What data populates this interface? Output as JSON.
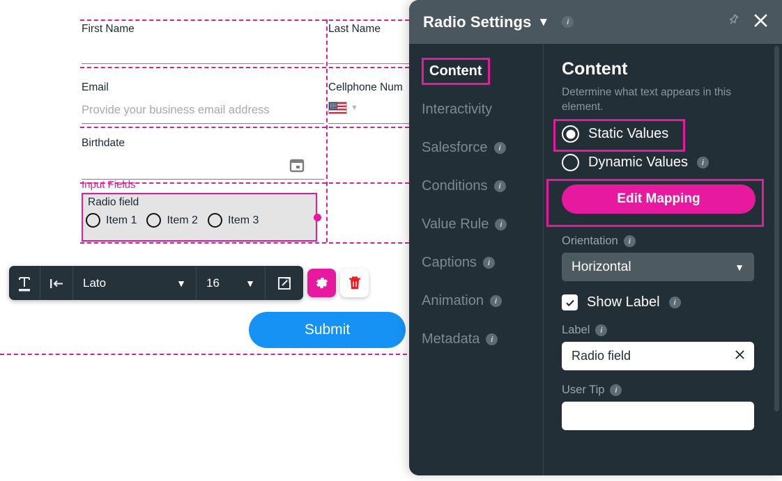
{
  "canvas": {
    "fields": [
      {
        "name": "first-name",
        "label": "First Name",
        "placeholder": "",
        "value": ""
      },
      {
        "name": "last-name",
        "label": "Last Name",
        "placeholder": "",
        "value": ""
      },
      {
        "name": "email",
        "label": "Email",
        "placeholder": "Provide your business email address",
        "value": ""
      },
      {
        "name": "cellphone",
        "label": "Cellphone Num",
        "placeholder": "",
        "value": ""
      },
      {
        "name": "birthdate",
        "label": "Birthdate",
        "placeholder": "",
        "value": ""
      }
    ],
    "selected_element": {
      "group_tag": "Input Fields",
      "label": "Radio field",
      "options": [
        "Item 1",
        "Item 2",
        "Item 3"
      ]
    },
    "submit_label": "Submit",
    "toolbar": {
      "text_icon": "text-format-icon",
      "align_icon": "align-left-icon",
      "font_family": "Lato",
      "font_size": "16",
      "link_icon": "external-link-icon",
      "gear_icon": "gear-icon",
      "trash_icon": "trash-icon"
    },
    "calendar_icon": "calendar-icon",
    "flag_icon": "us-flag-icon"
  },
  "panel": {
    "title": "Radio Settings",
    "title_chevron": "chevron-down-icon",
    "info_icon": "info-icon",
    "pin_icon": "pin-icon",
    "close_icon": "close-icon",
    "nav": [
      {
        "label": "Content",
        "info": false,
        "active": true
      },
      {
        "label": "Interactivity",
        "info": false,
        "active": false
      },
      {
        "label": "Salesforce",
        "info": true,
        "active": false
      },
      {
        "label": "Conditions",
        "info": true,
        "active": false
      },
      {
        "label": "Value Rule",
        "info": true,
        "active": false
      },
      {
        "label": "Captions",
        "info": true,
        "active": false
      },
      {
        "label": "Animation",
        "info": true,
        "active": false
      },
      {
        "label": "Metadata",
        "info": true,
        "active": false
      }
    ],
    "section": {
      "title": "Content",
      "description": "Determine what text appears in this element.",
      "static_values_label": "Static Values",
      "dynamic_values_label": "Dynamic Values",
      "edit_mapping_label": "Edit Mapping",
      "orientation_label": "Orientation",
      "orientation_value": "Horizontal",
      "orientation_chevron": "chevron-down-icon",
      "show_label_label": "Show Label",
      "label_label": "Label",
      "label_value": "Radio field",
      "label_clear_icon": "close-icon",
      "user_tip_label": "User Tip",
      "user_tip_value": ""
    }
  },
  "colors": {
    "accent_magenta": "#e6199f",
    "panel_bg": "#232f36",
    "panel_header": "#4a575e",
    "submit_blue": "#1592f3",
    "guide_dash": "#d6219b"
  }
}
